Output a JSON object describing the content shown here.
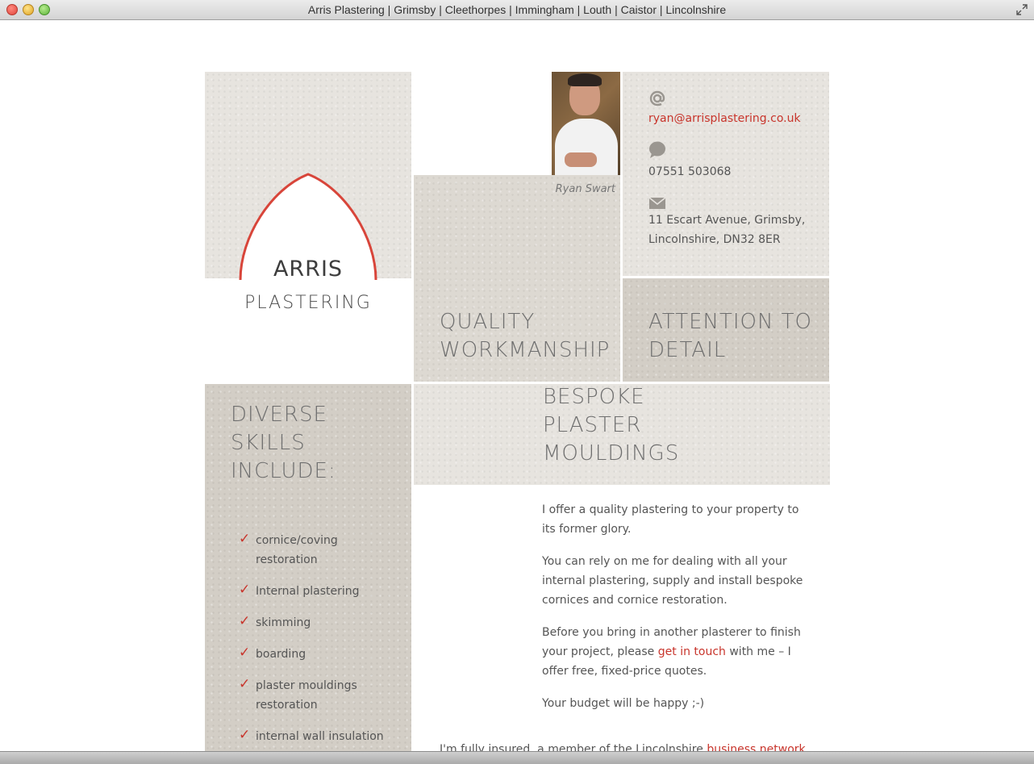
{
  "window": {
    "title": "Arris Plastering | Grimsby | Cleethorpes | Immingham | Louth | Caistor | Lincolnshire"
  },
  "logo": {
    "line1": "ARRIS",
    "line2": "PLASTERING",
    "arch_color": "#d8453a"
  },
  "photo": {
    "caption": "Ryan Swart"
  },
  "contact": {
    "email": "ryan@arrisplastering.co.uk",
    "phone": "07551 503068",
    "address_line1": "11 Escart Avenue, Grimsby,",
    "address_line2": "Lincolnshire, DN32 8ER",
    "icons": [
      "at-icon",
      "speech-bubble-icon",
      "envelope-icon"
    ]
  },
  "headings": {
    "quality_line1": "QUALITY",
    "quality_line2": "WORKMANSHIP",
    "attention_line1": "ATTENTION TO",
    "attention_line2": "DETAIL",
    "skills_line1": "DIVERSE",
    "skills_line2": "SKILLS",
    "skills_line3": "INCLUDE:",
    "bespoke_line1": "BESPOKE",
    "bespoke_line2": "PLASTER",
    "bespoke_line3": "MOULDINGS"
  },
  "skills": {
    "tick": "✓",
    "items": [
      "cornice/coving restoration",
      "Internal plastering",
      "skimming",
      "boarding",
      "plaster mouldings restoration",
      "internal wall insulation"
    ]
  },
  "copy": {
    "p1": "I offer a quality plastering to your property to its former glory.",
    "p2": "You can rely on me for dealing with all your internal plastering, supply and install bespoke cornices and cornice restoration.",
    "p3_before": "Before you bring in another plasterer to finish your project, please ",
    "p3_link": "get in touch",
    "p3_after": " with me – I offer free, fixed-price quotes.",
    "p4": "Your budget will be happy ;-)",
    "footer_before": "I'm fully insured, a member of the Lincolnshire ",
    "footer_link": "business network"
  },
  "colors": {
    "accent_red": "#c8352c",
    "tile_light": "#e7e4df",
    "tile_dark": "#d3cec6",
    "text": "#555555"
  }
}
